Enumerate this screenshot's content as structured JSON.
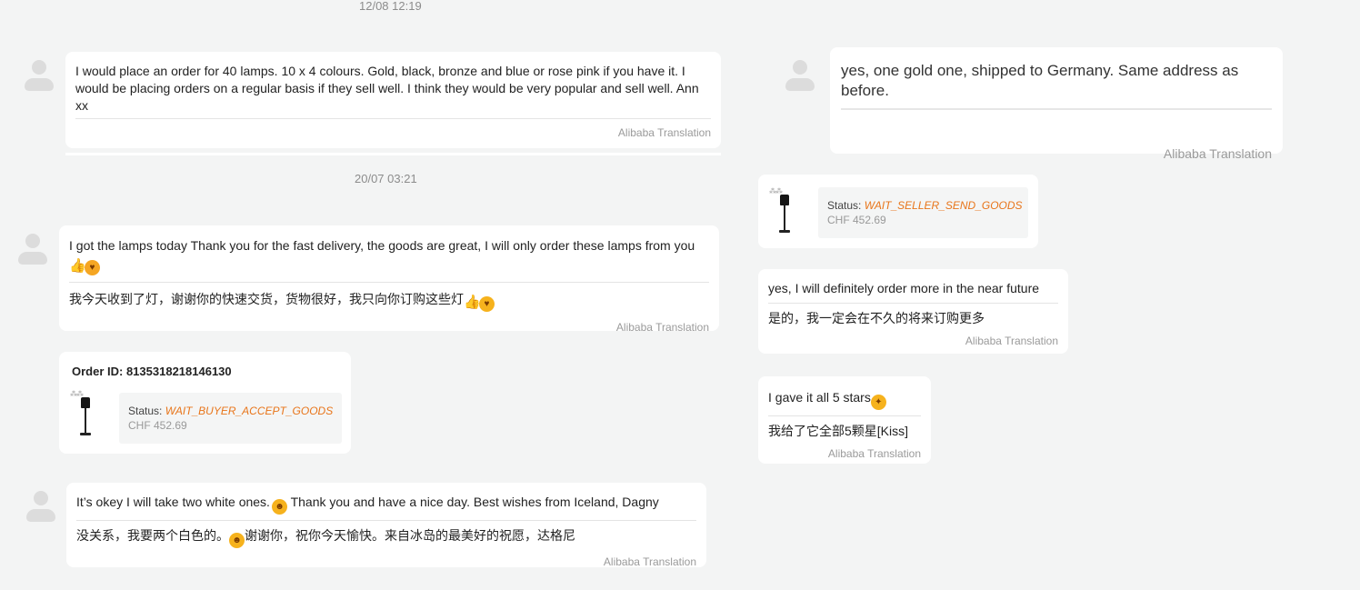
{
  "timestamps": [
    "12/08 12:19",
    "20/07 03:21"
  ],
  "translation_label": "Alibaba Translation",
  "left": {
    "msg1": {
      "text": "I would place an order for 40 lamps. 10 x 4 colours. Gold, black, bronze and blue or rose pink if you have it. I would be placing orders on a regular basis if they sell well. I think they would be very popular and sell well. Ann xx"
    },
    "msg2": {
      "text": "I got the lamps today Thank you for the fast delivery, the goods are great, I will only order these lamps from you",
      "translation": "我今天收到了灯，谢谢你的快速交货，货物很好，我只向你订购这些灯"
    },
    "order": {
      "id_label": "Order ID: 8135318218146130",
      "status_label": "Status:",
      "status_value": "WAIT_BUYER_ACCEPT_GOODS",
      "price": "CHF 452.69"
    },
    "msg3": {
      "text_a": "It’s okey I will take two white ones.",
      "text_b": " Thank you and have a nice day. Best wishes from Iceland, Dagny",
      "translation_a": "没关系，我要两个白色的。",
      "translation_b": "谢谢你，祝你今天愉快。来自冰岛的最美好的祝愿，达格尼"
    }
  },
  "right": {
    "msg1": {
      "text": "yes, one gold one, shipped to Germany. Same address as before."
    },
    "order": {
      "status_label": "Status:",
      "status_value": "WAIT_SELLER_SEND_GOODS",
      "price": "CHF 452.69"
    },
    "msg2": {
      "text": "yes, I will definitely order more in the near future",
      "translation": "是的，我一定会在不久的将来订购更多"
    },
    "msg3": {
      "text": "I gave it all 5 stars",
      "translation": "我给了它全部5颗星[Kiss]"
    }
  },
  "icons": {
    "thumbs_up": "thumbs-up-emoji",
    "heart_eyes": "heart-eyes-emoji",
    "grin": "grinning-emoji",
    "party": "party-face-emoji"
  },
  "colors": {
    "status_orange": "#e8751a",
    "background": "#f3f4f4"
  }
}
